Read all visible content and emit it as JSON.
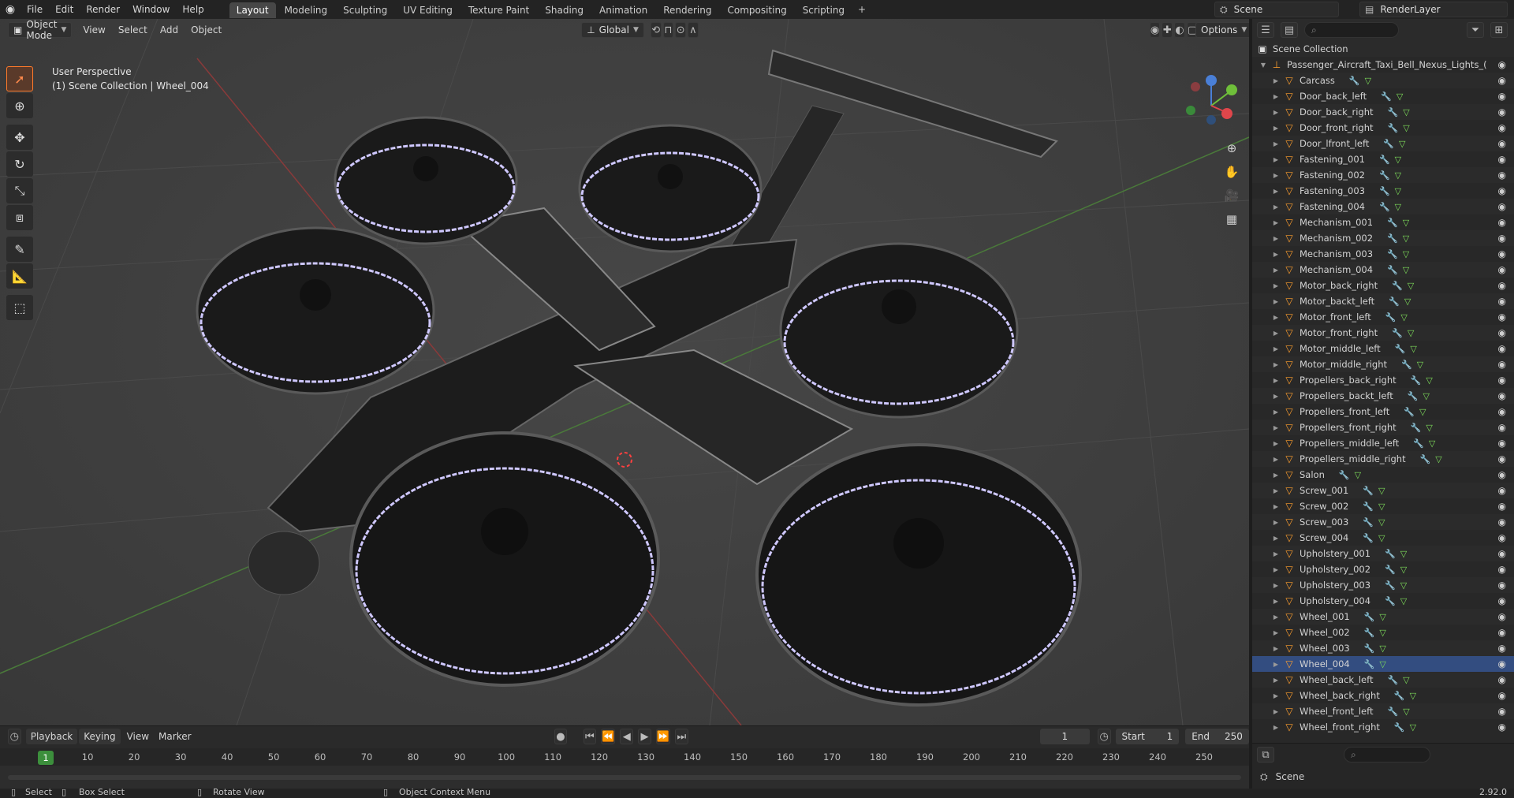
{
  "menu": [
    "File",
    "Edit",
    "Render",
    "Window",
    "Help"
  ],
  "workspaces": [
    {
      "label": "Layout",
      "active": true
    },
    {
      "label": "Modeling"
    },
    {
      "label": "Sculpting"
    },
    {
      "label": "UV Editing"
    },
    {
      "label": "Texture Paint"
    },
    {
      "label": "Shading"
    },
    {
      "label": "Animation"
    },
    {
      "label": "Rendering"
    },
    {
      "label": "Compositing"
    },
    {
      "label": "Scripting"
    }
  ],
  "scene_name": "Scene",
  "render_layer": "RenderLayer",
  "viewport": {
    "mode": "Object Mode",
    "menu": [
      "View",
      "Select",
      "Add",
      "Object"
    ],
    "transform": "Global",
    "options": "Options",
    "info_line1": "User Perspective",
    "info_line2": "(1) Scene Collection | Wheel_004"
  },
  "outliner": {
    "root": "Scene Collection",
    "collection": "Passenger_Aircraft_Taxi_Bell_Nexus_Lights_(",
    "selected": "Wheel_004",
    "items": [
      "Carcass",
      "Door_back_left",
      "Door_back_right",
      "Door_front_right",
      "Door_lfront_left",
      "Fastening_001",
      "Fastening_002",
      "Fastening_003",
      "Fastening_004",
      "Mechanism_001",
      "Mechanism_002",
      "Mechanism_003",
      "Mechanism_004",
      "Motor_back_right",
      "Motor_backt_left",
      "Motor_front_left",
      "Motor_front_right",
      "Motor_middle_left",
      "Motor_middle_right",
      "Propellers_back_right",
      "Propellers_backt_left",
      "Propellers_front_left",
      "Propellers_front_right",
      "Propellers_middle_left",
      "Propellers_middle_right",
      "Salon",
      "Screw_001",
      "Screw_002",
      "Screw_003",
      "Screw_004",
      "Upholstery_001",
      "Upholstery_002",
      "Upholstery_003",
      "Upholstery_004",
      "Wheel_001",
      "Wheel_002",
      "Wheel_003",
      "Wheel_004",
      "Wheel_back_left",
      "Wheel_back_right",
      "Wheel_front_left",
      "Wheel_front_right"
    ]
  },
  "props": {
    "scene": "Scene"
  },
  "timeline": {
    "menu": [
      "Playback",
      "Keying",
      "View",
      "Marker"
    ],
    "current_frame": "1",
    "start_label": "Start",
    "start": "1",
    "end_label": "End",
    "end": "250",
    "ticks": [
      "1",
      "10",
      "20",
      "30",
      "40",
      "50",
      "60",
      "70",
      "80",
      "90",
      "100",
      "110",
      "120",
      "130",
      "140",
      "150",
      "160",
      "170",
      "180",
      "190",
      "200",
      "210",
      "220",
      "230",
      "240",
      "250"
    ]
  },
  "status": {
    "select": "Select",
    "box_select": "Box Select",
    "rotate": "Rotate View",
    "context": "Object Context Menu",
    "version": "2.92.0"
  },
  "colors": {
    "selected_row": "#334d80",
    "object_icon": "#ff9f2e",
    "active_tool": "#ff7a2a",
    "playhead": "#3c8f3c"
  }
}
